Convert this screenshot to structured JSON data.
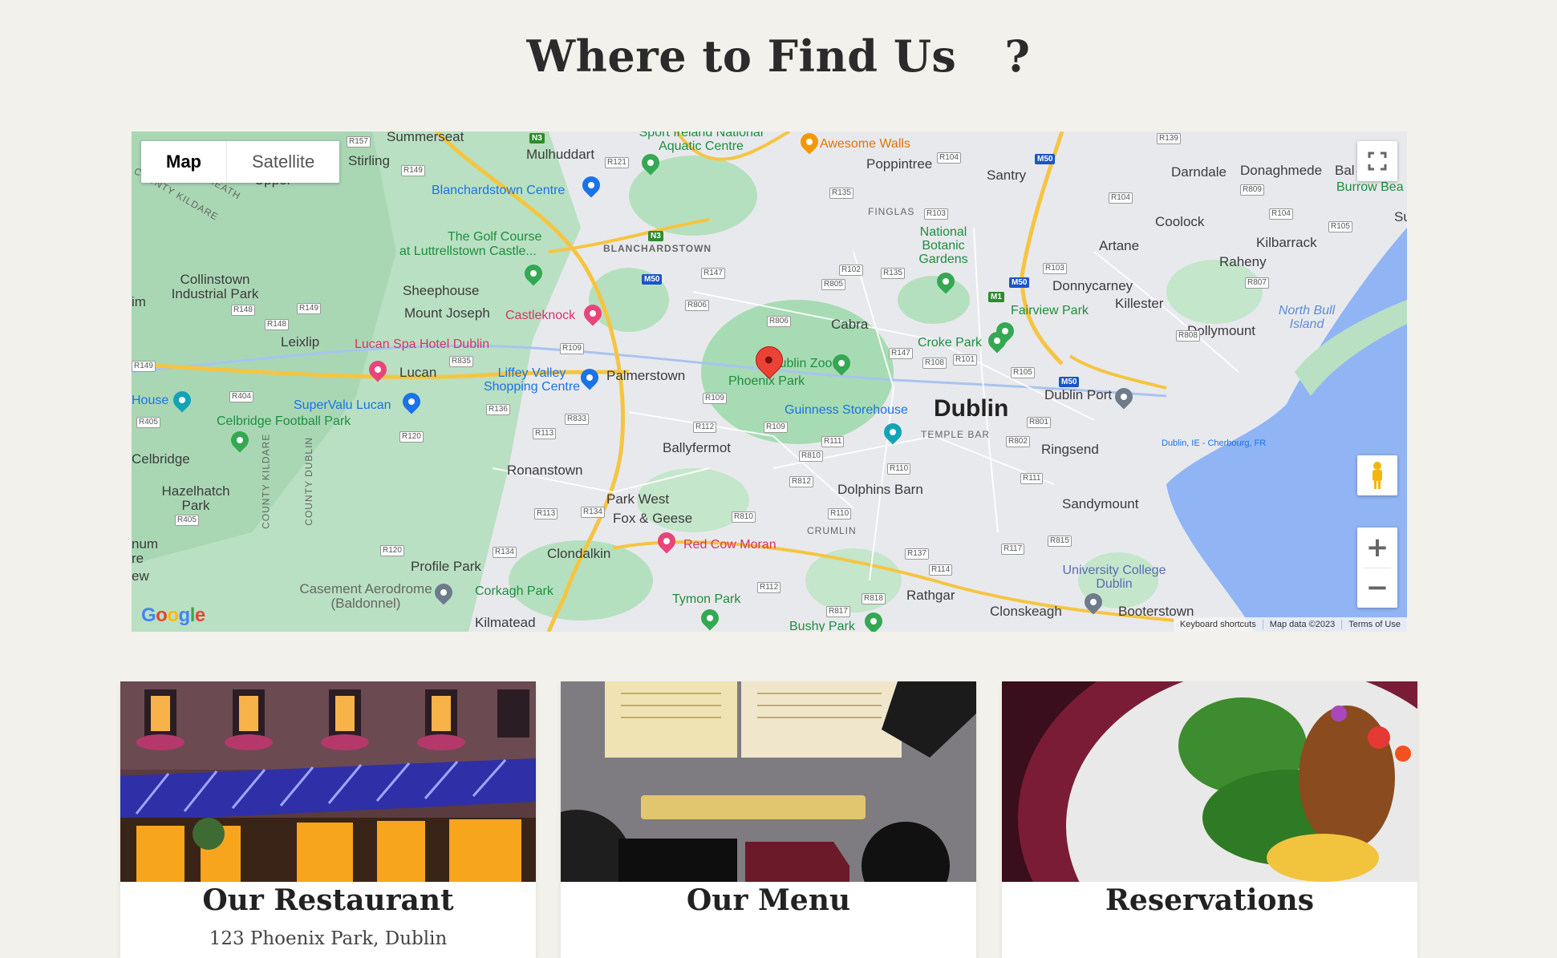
{
  "page": {
    "heading": "Where to Find Us",
    "heading_icon": "?"
  },
  "map": {
    "tabs": [
      "Map",
      "Satellite"
    ],
    "footer": {
      "shortcuts": "Keyboard shortcuts",
      "data": "Map data ©2023",
      "terms": "Terms of Use"
    },
    "logo": "Google",
    "icons": {
      "fullscreen": "fullscreen-icon",
      "pegman": "pegman-icon",
      "zoom_in": "+",
      "zoom_out": "−"
    },
    "labels": {
      "summerseat": "Summerseat",
      "mulhuddart": "Mulhuddart",
      "sport_ireland": "Sport Ireland National Aquatic Centre",
      "awesome_walls": "Awesome Walls",
      "poppintree": "Poppintree",
      "santry": "Santry",
      "darndale": "Darndale",
      "donaghmede": "Donaghmede",
      "bal": "Bal",
      "burrow": "Burrow Bea",
      "stirling": "Stirling",
      "upper": "Upper",
      "county_kildare_top": "COUNTY KILDARE",
      "meath": "MEATH",
      "blanchardstown_centre": "Blanchardstown Centre",
      "finglas": "FINGLAS",
      "coolock": "Coolock",
      "su": "Su",
      "golf1": "The Golf Course",
      "golf2": "at Luttrellstown Castle...",
      "blanchardstown": "BLANCHARDSTOWN",
      "national_botanic": "National Botanic Gardens",
      "artane": "Artane",
      "kilbarrack": "Kilbarrack",
      "raheny": "Raheny",
      "collinstown": "Collinstown Industrial Park",
      "sheephouse": "Sheephouse",
      "donnycarney": "Donnycarney",
      "killester": "Killester",
      "mount_joseph": "Mount Joseph",
      "castleknock": "Castleknock",
      "fairview": "Fairview Park",
      "north_bull": "North Bull Island",
      "dollymount": "Dollymount",
      "leixlip": "Leixlip",
      "lucan_spa": "Lucan Spa Hotel Dublin",
      "cabra": "Cabra",
      "croke": "Croke Park",
      "lucan": "Lucan",
      "liffey": "Liffey Valley Shopping Centre",
      "palmerstown": "Palmerstown",
      "zoo": "Dublin Zoo",
      "phoenix": "Phoenix Park",
      "house": "House",
      "supervalu": "SuperValu Lucan",
      "guinness": "Guinness Storehouse",
      "dublin": "Dublin",
      "temple_bar": "TEMPLE BAR",
      "dublin_port": "Dublin Port",
      "celbridge_fc": "Celbridge Football Park",
      "ferry": "Dublin, IE - Cherbourg, FR",
      "celbridge": "Celbridge",
      "ballyfermot": "Ballyfermot",
      "ringsend": "Ringsend",
      "ronanstown": "Ronanstown",
      "hazelhatch": "Hazelhatch Park",
      "county_kildare": "COUNTY KILDARE",
      "county_dublin": "COUNTY DUBLIN",
      "park_west": "Park West",
      "dolphins": "Dolphins Barn",
      "fox": "Fox & Geese",
      "sandymount": "Sandymount",
      "crumlin": "CRUMLIN",
      "red_cow": "Red Cow Moran",
      "clondalkin": "Clondalkin",
      "profile": "Profile Park",
      "university": "University College Dublin",
      "casement": "Casement Aerodrome (Baldonnel)",
      "corkagh": "Corkagh Park",
      "tymon": "Tymon Park",
      "rathgar": "Rathgar",
      "clonskeagh": "Clonskeagh",
      "booterstown": "Booterstown",
      "kilmatead": "Kilmatead",
      "bushy": "Bushy Park",
      "im": "im",
      "num": "num",
      "re": "re",
      "ew": "ew"
    },
    "roads": {
      "r157": "R157",
      "r121": "R121",
      "r104a": "R104",
      "r139": "R139",
      "r149a": "R149",
      "r135a": "R135",
      "r103a": "R103",
      "r809": "R809",
      "r104b": "R104",
      "r104c": "R104",
      "r105a": "R105",
      "r147a": "R147",
      "r102": "R102",
      "r135b": "R135",
      "r805": "R805",
      "r103b": "R103",
      "r807": "R807",
      "r148a": "R148",
      "r149b": "R149",
      "r148b": "R148",
      "r806a": "R806",
      "r806b": "R806",
      "r808": "R808",
      "r109a": "R109",
      "r835": "R835",
      "r147b": "R147",
      "r108": "R108",
      "r101": "R101",
      "r105b": "R105",
      "r149c": "R149",
      "r404": "R404",
      "r136": "R136",
      "r109b": "R109",
      "r405a": "R405",
      "r833": "R833",
      "r112a": "R112",
      "r109c": "R109",
      "r801": "R801",
      "r120a": "R120",
      "r113a": "R113",
      "r111a": "R111",
      "r802": "R802",
      "r810a": "R810",
      "r110a": "R110",
      "r812": "R812",
      "r111b": "R111",
      "r113b": "R113",
      "r134a": "R134",
      "r810b": "R810",
      "r110b": "R110",
      "r405b": "R405",
      "r137": "R137",
      "r117": "R117",
      "r815": "R815",
      "r120b": "R120",
      "r134b": "R134",
      "r114": "R114",
      "r112b": "R112",
      "r817": "R817",
      "r818": "R818"
    },
    "motorways": {
      "m50a": "M50",
      "m50b": "M50",
      "m50c": "M50",
      "m50d": "M50",
      "n3a": "N3",
      "n3b": "N3",
      "m1": "M1"
    }
  },
  "cards": [
    {
      "title": "Our Restaurant",
      "subtitle": "123 Phoenix Park, Dublin"
    },
    {
      "title": "Our Menu",
      "subtitle": ""
    },
    {
      "title": "Reservations",
      "subtitle": ""
    }
  ],
  "colors": {
    "background": "#f3f1eb",
    "marker": "#ea4335",
    "water": "#90b4f4",
    "park": "#a8dab5"
  }
}
